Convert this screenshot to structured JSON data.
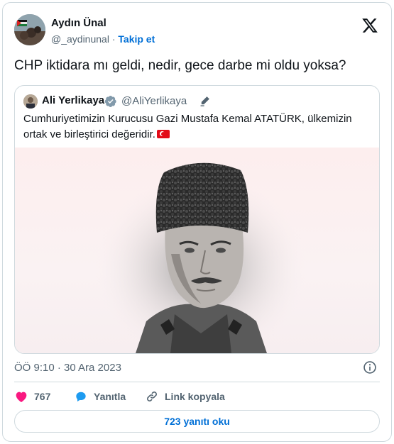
{
  "author": {
    "name": "Aydın Ünal",
    "handle": "@_aydinunal",
    "separator": "·",
    "follow_label": "Takip et"
  },
  "tweet": {
    "text": "CHP iktidara mı geldi, nedir, gece darbe mi oldu yoksa?",
    "timestamp": "ÖÖ 9:10 · 30 Ara 2023"
  },
  "quoted": {
    "name": "Ali Yerlikaya",
    "handle": "@AliYerlikaya",
    "text": "Cumhuriyetimizin Kurucusu Gazi Mustafa Kemal ATATÜRK, ülkemizin ortak ve birleştirici değeridir."
  },
  "actions": {
    "like_count": "767",
    "reply_label": "Yanıtla",
    "copy_label": "Link kopyala"
  },
  "read_replies_label": "723 yanıtı oku",
  "colors": {
    "accent": "#006fd6",
    "like": "#f91880",
    "reply": "#1d9bf0",
    "verified": "#829aab",
    "border": "#cfd9de",
    "muted": "#536471"
  }
}
